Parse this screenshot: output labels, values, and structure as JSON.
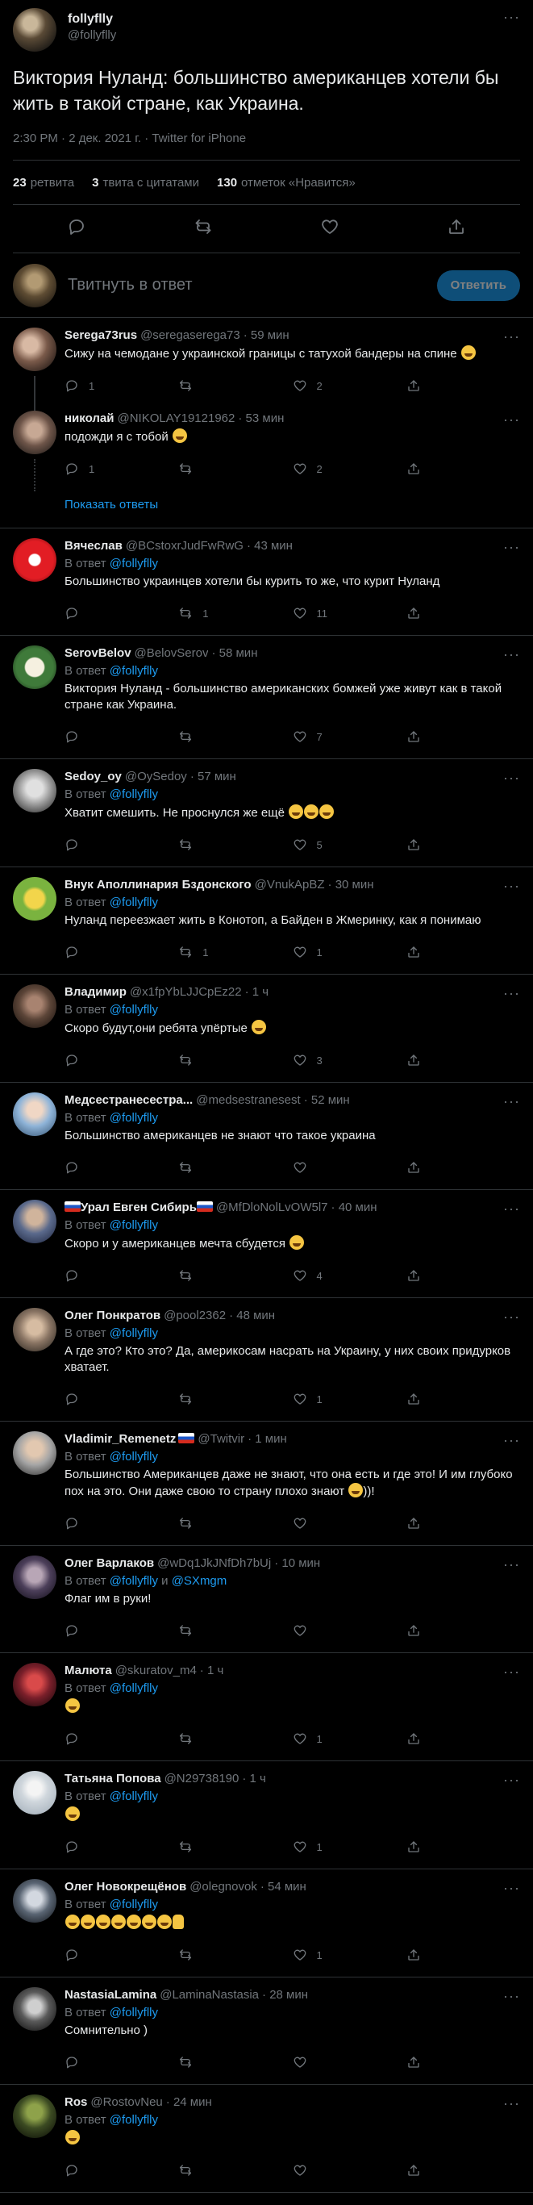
{
  "main": {
    "name": "follyflly",
    "handle": "@follyflly",
    "text": "Виктория Нуланд: большинство американцев хотели бы жить в такой стране, как Украина.",
    "meta": "2:30 PM · 2 дек. 2021 г. · Twitter for iPhone",
    "retweets_count": "23",
    "retweets_label": "ретвита",
    "quotes_count": "3",
    "quotes_label": "твита с цитатами",
    "likes_count": "130",
    "likes_label": "отметок «Нравится»"
  },
  "reply_box": {
    "placeholder": "Твитнуть в ответ",
    "button": "Ответить"
  },
  "replying_label": "В ответ",
  "and_label": "и",
  "show_replies": "Показать ответы",
  "replies": [
    {
      "name": "Serega73rus",
      "handle": "@seregaserega73",
      "time": "· 59 мин",
      "replying": "",
      "text": "Сижу на чемодане у украинской границы с татухой бандеры на спине",
      "emoji": "😂",
      "reply_count": "1",
      "retweet_count": "",
      "like_count": "2"
    },
    {
      "name": "николай",
      "handle": "@NIKOLAY19121962",
      "time": "· 53 мин",
      "replying": "",
      "text": "подожди я с тобой",
      "emoji": "🤣",
      "reply_count": "1",
      "retweet_count": "",
      "like_count": "2"
    },
    {
      "name": "Вячеслав",
      "handle": "@BCstoxrJudFwRwG",
      "time": "· 43 мин",
      "replying": "@follyflly",
      "text": "Большинство украинцев хотели бы курить то же, что курит Нуланд",
      "emoji": "",
      "reply_count": "",
      "retweet_count": "1",
      "like_count": "11"
    },
    {
      "name": "SerovBelov",
      "handle": "@BelovSerov",
      "time": "· 58 мин",
      "replying": "@follyflly",
      "text": "Виктория Нуланд - большинство американских бомжей уже живут как в такой стране как Украина.",
      "emoji": "",
      "reply_count": "",
      "retweet_count": "",
      "like_count": "7"
    },
    {
      "name": "Sedoy_oy",
      "handle": "@OySedoy",
      "time": "· 57 мин",
      "replying": "@follyflly",
      "text": "Хватит смешить. Не проснулся же ещё",
      "emoji": "🤣🤣🤣",
      "reply_count": "",
      "retweet_count": "",
      "like_count": "5"
    },
    {
      "name": "Внук Аполлинария Бздонского",
      "handle": "@VnukApBZ",
      "time": "· 30 мин",
      "replying": "@follyflly",
      "text": "Нуланд переезжает жить в Конотоп, а Байден в Жмеринку, как я понимаю",
      "emoji": "",
      "reply_count": "",
      "retweet_count": "1",
      "like_count": "1"
    },
    {
      "name": "Владимир",
      "handle": "@x1fpYbLJJCpEz22",
      "time": "· 1 ч",
      "replying": "@follyflly",
      "text": "Скоро будут,они ребята упёртые",
      "emoji": "🤣",
      "reply_count": "",
      "retweet_count": "",
      "like_count": "3"
    },
    {
      "name": "Медсестранесестра...",
      "handle": "@medsestranesest",
      "time": "· 52 мин",
      "replying": "@follyflly",
      "text": "Большинство американцев не знают что такое украина",
      "emoji": "",
      "reply_count": "",
      "retweet_count": "",
      "like_count": ""
    },
    {
      "name": "Урал Евген Сибирь",
      "handle": "@MfDloNolLvOW5l7",
      "time": "· 40 мин",
      "replying": "@follyflly",
      "text": "Скоро и у американцев мечта сбудется",
      "emoji": "😂",
      "reply_count": "",
      "retweet_count": "",
      "like_count": "4"
    },
    {
      "name": "Олег Понкратов",
      "handle": "@pool2362",
      "time": "· 48 мин",
      "replying": "@follyflly",
      "text": "А где это? Кто это? Да, америкосам насрать на Украину, у них своих придурков хватает.",
      "emoji": "",
      "reply_count": "",
      "retweet_count": "",
      "like_count": "1"
    },
    {
      "name": "Vladimir_Remenetz",
      "handle": "@Twitvir",
      "time": "· 1 мин",
      "replying": "@follyflly",
      "text": "Большинство Американцев даже не знают, что она есть и где это! И им глубоко пох на это. Они даже свою то страну плохо знают",
      "emoji": "😂",
      "text_after": "))!",
      "reply_count": "",
      "retweet_count": "",
      "like_count": ""
    },
    {
      "name": "Олег Варлаков",
      "handle": "@wDq1JkJNfDh7bUj",
      "time": "· 10 мин",
      "replying": "@follyflly",
      "replying2": "@SXmgm",
      "text": "Флаг им в руки!",
      "emoji": "",
      "reply_count": "",
      "retweet_count": "",
      "like_count": ""
    },
    {
      "name": "Малюта",
      "handle": "@skuratov_m4",
      "time": "· 1 ч",
      "replying": "@follyflly",
      "text": "",
      "emoji": "😂",
      "reply_count": "",
      "retweet_count": "",
      "like_count": "1"
    },
    {
      "name": "Татьяна Попова",
      "handle": "@N29738190",
      "time": "· 1 ч",
      "replying": "@follyflly",
      "text": "",
      "emoji": "🙂",
      "reply_count": "",
      "retweet_count": "",
      "like_count": "1"
    },
    {
      "name": "Олег Новокрещёнов",
      "handle": "@olegnovok",
      "time": "· 54 мин",
      "replying": "@follyflly",
      "text": "",
      "emoji": "🤣🤣🤣🤣🤣🤣🤣👍",
      "reply_count": "",
      "retweet_count": "",
      "like_count": "1"
    },
    {
      "name": "NastasiaLamina",
      "handle": "@LaminaNastasia",
      "time": "· 28 мин",
      "replying": "@follyflly",
      "text": "Сомнительно )",
      "emoji": "",
      "reply_count": "",
      "retweet_count": "",
      "like_count": ""
    },
    {
      "name": "Ros",
      "handle": "@RostovNeu",
      "time": "· 24 мин",
      "replying": "@follyflly",
      "text": "",
      "emoji": "🤣",
      "reply_count": "",
      "retweet_count": "",
      "like_count": ""
    }
  ],
  "icons": {
    "reply": "reply-icon",
    "retweet": "retweet-icon",
    "like": "heart-icon",
    "share": "share-icon",
    "more": "more-icon"
  },
  "colors": {
    "accent": "#1d9bf0",
    "background": "#000000",
    "muted": "#71767b",
    "border": "#2f3336"
  }
}
